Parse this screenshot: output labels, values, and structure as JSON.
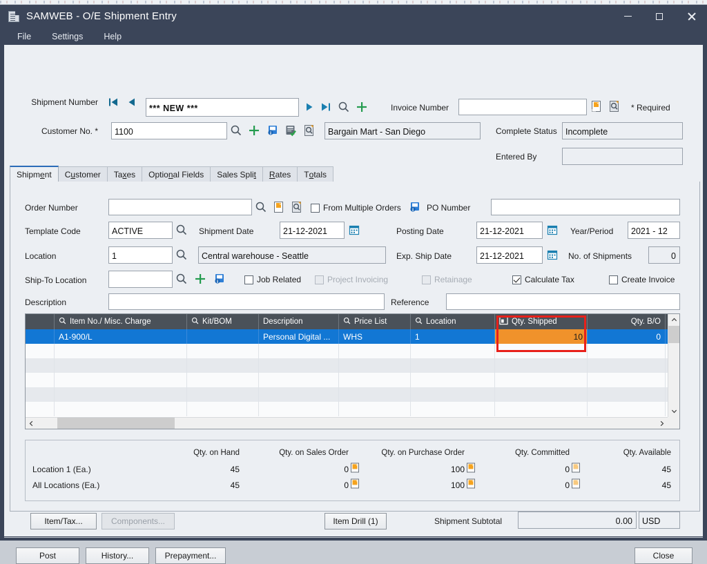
{
  "window": {
    "title": "SAMWEB - O/E Shipment Entry",
    "icon": "document-icon",
    "controls": {
      "minimize": "minimize-icon",
      "maximize": "maximize-icon",
      "close": "close-icon"
    }
  },
  "menubar": {
    "items": [
      "File",
      "Settings",
      "Help"
    ]
  },
  "header": {
    "shipment_number_label": "Shipment Number",
    "shipment_number_value": "*** NEW ***",
    "customer_no_label": "Customer No. *",
    "customer_no_value": "1100",
    "customer_name_value": "Bargain Mart - San Diego",
    "invoice_number_label": "Invoice Number",
    "invoice_number_value": "",
    "required_note": "* Required",
    "complete_status_label": "Complete Status",
    "complete_status_value": "Incomplete",
    "entered_by_label": "Entered By",
    "entered_by_value": ""
  },
  "tabs": [
    {
      "label": "Shipment",
      "mnemonic": "e",
      "active": true
    },
    {
      "label": "Customer",
      "mnemonic": "u",
      "active": false
    },
    {
      "label": "Taxes",
      "mnemonic": "x",
      "active": false
    },
    {
      "label": "Optional Fields",
      "mnemonic": "n",
      "active": false
    },
    {
      "label": "Sales Split",
      "mnemonic": "t",
      "active": false
    },
    {
      "label": "Rates",
      "mnemonic": "R",
      "active": false
    },
    {
      "label": "Totals",
      "mnemonic": "o",
      "active": false
    }
  ],
  "form": {
    "order_number_label": "Order Number",
    "order_number_value": "",
    "from_multiple_orders_label": "From Multiple Orders",
    "from_multiple_orders_checked": false,
    "po_number_label": "PO Number",
    "po_number_value": "",
    "template_code_label": "Template Code",
    "template_code_value": "ACTIVE",
    "shipment_date_label": "Shipment Date",
    "shipment_date_value": "21-12-2021",
    "posting_date_label": "Posting Date",
    "posting_date_value": "21-12-2021",
    "year_period_label": "Year/Period",
    "year_period_value": "2021 - 12",
    "location_label": "Location",
    "location_value": "1",
    "location_desc_value": "Central warehouse - Seattle",
    "exp_ship_date_label": "Exp. Ship Date",
    "exp_ship_date_value": "21-12-2021",
    "no_of_shipments_label": "No. of Shipments",
    "no_of_shipments_value": "0",
    "ship_to_location_label": "Ship-To Location",
    "ship_to_location_value": "",
    "job_related_label": "Job Related",
    "job_related_checked": false,
    "project_invoicing_label": "Project Invoicing",
    "project_invoicing_checked": false,
    "project_invoicing_disabled": true,
    "retainage_label": "Retainage",
    "retainage_checked": false,
    "retainage_disabled": true,
    "calculate_tax_label": "Calculate Tax",
    "calculate_tax_checked": true,
    "create_invoice_label": "Create Invoice",
    "create_invoice_checked": false,
    "description_label": "Description",
    "description_value": "",
    "reference_label": "Reference",
    "reference_value": ""
  },
  "grid": {
    "columns": [
      {
        "label": "Item No./ Misc. Charge",
        "icon": "search-icon",
        "align": "left",
        "width": 192
      },
      {
        "label": "Kit/BOM",
        "icon": "search-icon",
        "align": "left",
        "width": 104
      },
      {
        "label": "Description",
        "icon": "",
        "align": "left",
        "width": 116
      },
      {
        "label": "Price List",
        "icon": "search-icon",
        "align": "left",
        "width": 104
      },
      {
        "label": "Location",
        "icon": "search-icon",
        "align": "left",
        "width": 122
      },
      {
        "label": "Qty. Shipped",
        "icon": "finder-icon",
        "align": "right",
        "width": 134
      },
      {
        "label": "Qty. B/O",
        "icon": "",
        "align": "right",
        "width": 113
      }
    ],
    "rows": [
      {
        "selected": true,
        "cells": [
          "A1-900/L",
          "",
          "Personal Digital ...",
          "WHS",
          "1",
          "10",
          "0"
        ]
      }
    ],
    "empty_row_count": 5,
    "highlight_column_index": 5,
    "highlight_color": "#e8201a",
    "highlight_cell_color": "#f0922b"
  },
  "quantities": {
    "column_headers": [
      "Qty. on Hand",
      "Qty. on Sales Order",
      "Qty. on Purchase Order",
      "Qty. Committed",
      "Qty. Available"
    ],
    "rows": [
      {
        "label": "Location     1 (Ea.)",
        "values": [
          "45",
          "0",
          "100",
          "0",
          "45"
        ]
      },
      {
        "label": "All Locations (Ea.)",
        "values": [
          "45",
          "0",
          "100",
          "0",
          "45"
        ]
      }
    ]
  },
  "footer": {
    "item_tax_button": "Item/Tax...",
    "components_button": "Components...",
    "components_disabled": true,
    "item_drill_button": "Item Drill (1)",
    "shipment_subtotal_label": "Shipment Subtotal",
    "shipment_subtotal_value": "0.00",
    "currency_value": "USD",
    "post_button": "Post",
    "history_button": "History...",
    "prepayment_button": "Prepayment...",
    "close_button": "Close"
  },
  "colors": {
    "titlebar": "#3b4559",
    "accent": "#2b6cb8",
    "selection": "#1277d4",
    "highlight_red": "#e8201a",
    "highlight_orange": "#f0922b"
  }
}
